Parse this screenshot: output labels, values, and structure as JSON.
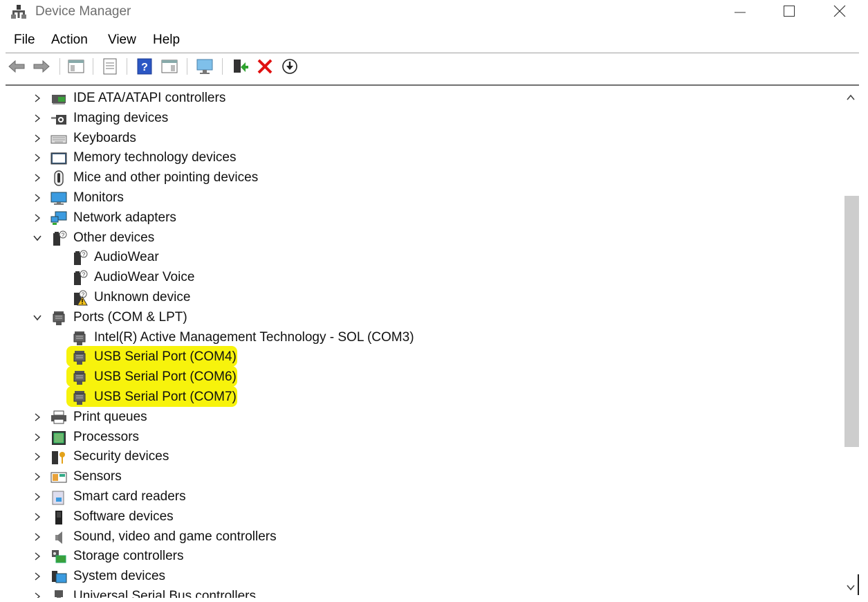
{
  "window": {
    "title": "Device Manager"
  },
  "menu": [
    "File",
    "Action",
    "View",
    "Help"
  ],
  "toolbar": {
    "icons": [
      "back-arrow-icon",
      "forward-arrow-icon",
      "show-hide-console-tree-icon",
      "properties-icon",
      "help-icon",
      "action-pane-icon",
      "scan-hardware-icon",
      "update-driver-icon",
      "uninstall-icon",
      "disable-device-icon"
    ]
  },
  "tree": {
    "rows": [
      {
        "label": "IDE ATA/ATAPI controllers",
        "level": 0,
        "state": "collapsed",
        "icon": "ide-controller-icon"
      },
      {
        "label": "Imaging devices",
        "level": 0,
        "state": "collapsed",
        "icon": "imaging-device-icon"
      },
      {
        "label": "Keyboards",
        "level": 0,
        "state": "collapsed",
        "icon": "keyboard-icon"
      },
      {
        "label": "Memory technology devices",
        "level": 0,
        "state": "collapsed",
        "icon": "memory-device-icon"
      },
      {
        "label": "Mice and other pointing devices",
        "level": 0,
        "state": "collapsed",
        "icon": "mouse-icon"
      },
      {
        "label": "Monitors",
        "level": 0,
        "state": "collapsed",
        "icon": "monitor-icon"
      },
      {
        "label": "Network adapters",
        "level": 0,
        "state": "collapsed",
        "icon": "network-adapter-icon"
      },
      {
        "label": "Other devices",
        "level": 0,
        "state": "expanded",
        "icon": "unknown-device-icon"
      },
      {
        "label": "AudioWear",
        "level": 1,
        "state": "leaf",
        "icon": "unknown-device-icon"
      },
      {
        "label": "AudioWear Voice",
        "level": 1,
        "state": "leaf",
        "icon": "unknown-device-icon"
      },
      {
        "label": "Unknown device",
        "level": 1,
        "state": "leaf",
        "icon": "warning-device-icon"
      },
      {
        "label": "Ports (COM & LPT)",
        "level": 0,
        "state": "expanded",
        "icon": "port-icon"
      },
      {
        "label": "Intel(R) Active Management Technology - SOL (COM3)",
        "level": 1,
        "state": "leaf",
        "icon": "port-icon"
      },
      {
        "label": "USB Serial Port (COM4)",
        "level": 1,
        "state": "leaf",
        "icon": "port-icon",
        "highlighted": true
      },
      {
        "label": "USB Serial Port (COM6)",
        "level": 1,
        "state": "leaf",
        "icon": "port-icon",
        "highlighted": true
      },
      {
        "label": "USB Serial Port (COM7)",
        "level": 1,
        "state": "leaf",
        "icon": "port-icon",
        "highlighted": true
      },
      {
        "label": "Print queues",
        "level": 0,
        "state": "collapsed",
        "icon": "printer-icon"
      },
      {
        "label": "Processors",
        "level": 0,
        "state": "collapsed",
        "icon": "processor-icon"
      },
      {
        "label": "Security devices",
        "level": 0,
        "state": "collapsed",
        "icon": "security-device-icon"
      },
      {
        "label": "Sensors",
        "level": 0,
        "state": "collapsed",
        "icon": "sensor-icon"
      },
      {
        "label": "Smart card readers",
        "level": 0,
        "state": "collapsed",
        "icon": "smart-card-reader-icon"
      },
      {
        "label": "Software devices",
        "level": 0,
        "state": "collapsed",
        "icon": "software-device-icon"
      },
      {
        "label": "Sound, video and game controllers",
        "level": 0,
        "state": "collapsed",
        "icon": "speaker-icon"
      },
      {
        "label": "Storage controllers",
        "level": 0,
        "state": "collapsed",
        "icon": "storage-controller-icon"
      },
      {
        "label": "System devices",
        "level": 0,
        "state": "collapsed",
        "icon": "system-device-icon"
      },
      {
        "label": "Universal Serial Bus controllers",
        "level": 0,
        "state": "collapsed",
        "icon": "usb-controller-icon"
      }
    ]
  },
  "colors": {
    "highlight": "#f7f30c",
    "title_text": "#6e6e6e",
    "scroll_thumb": "#cdcdcd"
  }
}
